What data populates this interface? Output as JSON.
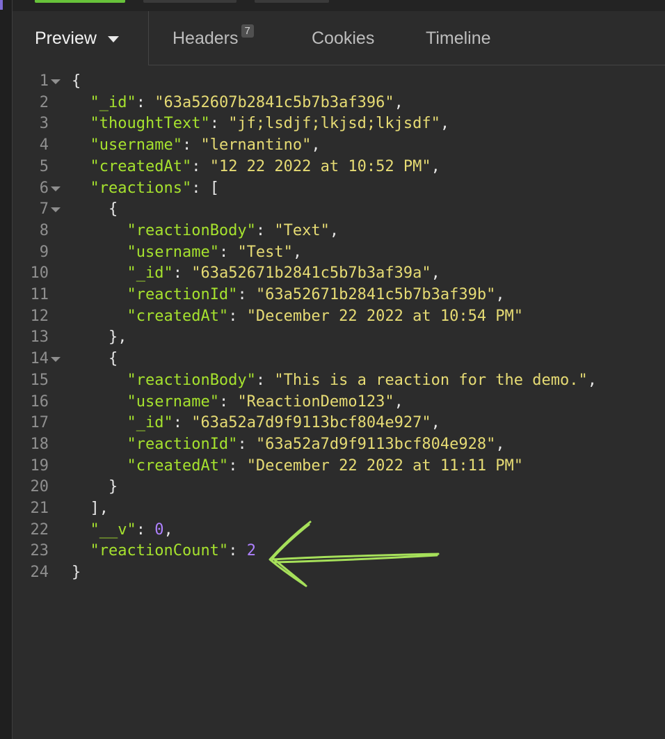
{
  "tabs": [
    {
      "label": "Preview",
      "badge": null,
      "active": true
    },
    {
      "label": "Headers",
      "badge": "7",
      "active": false
    },
    {
      "label": "Cookies",
      "badge": null,
      "active": false
    },
    {
      "label": "Timeline",
      "badge": null,
      "active": false
    }
  ],
  "colors": {
    "key": "#a6e22e",
    "string": "#e6db74",
    "number": "#ae81ff",
    "annotation_arrow": "#a6e05a",
    "top_segment_active": "#67c23a"
  },
  "lines": [
    {
      "n": "1",
      "fold": true,
      "tokens": [
        [
          "p",
          "{"
        ]
      ]
    },
    {
      "n": "2",
      "fold": false,
      "tokens": [
        [
          "p",
          "  "
        ],
        [
          "k",
          "\"_id\""
        ],
        [
          "p",
          ": "
        ],
        [
          "s",
          "\"63a52607b2841c5b7b3af396\""
        ],
        [
          "p",
          ","
        ]
      ]
    },
    {
      "n": "3",
      "fold": false,
      "tokens": [
        [
          "p",
          "  "
        ],
        [
          "k",
          "\"thoughtText\""
        ],
        [
          "p",
          ": "
        ],
        [
          "s",
          "\"jf;lsdjf;lkjsd;lkjsdf\""
        ],
        [
          "p",
          ","
        ]
      ]
    },
    {
      "n": "4",
      "fold": false,
      "tokens": [
        [
          "p",
          "  "
        ],
        [
          "k",
          "\"username\""
        ],
        [
          "p",
          ": "
        ],
        [
          "s",
          "\"lernantino\""
        ],
        [
          "p",
          ","
        ]
      ]
    },
    {
      "n": "5",
      "fold": false,
      "tokens": [
        [
          "p",
          "  "
        ],
        [
          "k",
          "\"createdAt\""
        ],
        [
          "p",
          ": "
        ],
        [
          "s",
          "\"12 22 2022 at 10:52 PM\""
        ],
        [
          "p",
          ","
        ]
      ]
    },
    {
      "n": "6",
      "fold": true,
      "tokens": [
        [
          "p",
          "  "
        ],
        [
          "k",
          "\"reactions\""
        ],
        [
          "p",
          ": ["
        ]
      ]
    },
    {
      "n": "7",
      "fold": true,
      "tokens": [
        [
          "p",
          "    {"
        ]
      ]
    },
    {
      "n": "8",
      "fold": false,
      "tokens": [
        [
          "p",
          "      "
        ],
        [
          "k",
          "\"reactionBody\""
        ],
        [
          "p",
          ": "
        ],
        [
          "s",
          "\"Text\""
        ],
        [
          "p",
          ","
        ]
      ]
    },
    {
      "n": "9",
      "fold": false,
      "tokens": [
        [
          "p",
          "      "
        ],
        [
          "k",
          "\"username\""
        ],
        [
          "p",
          ": "
        ],
        [
          "s",
          "\"Test\""
        ],
        [
          "p",
          ","
        ]
      ]
    },
    {
      "n": "10",
      "fold": false,
      "tokens": [
        [
          "p",
          "      "
        ],
        [
          "k",
          "\"_id\""
        ],
        [
          "p",
          ": "
        ],
        [
          "s",
          "\"63a52671b2841c5b7b3af39a\""
        ],
        [
          "p",
          ","
        ]
      ]
    },
    {
      "n": "11",
      "fold": false,
      "tokens": [
        [
          "p",
          "      "
        ],
        [
          "k",
          "\"reactionId\""
        ],
        [
          "p",
          ": "
        ],
        [
          "s",
          "\"63a52671b2841c5b7b3af39b\""
        ],
        [
          "p",
          ","
        ]
      ]
    },
    {
      "n": "12",
      "fold": false,
      "tokens": [
        [
          "p",
          "      "
        ],
        [
          "k",
          "\"createdAt\""
        ],
        [
          "p",
          ": "
        ],
        [
          "s",
          "\"December 22 2022 at 10:54 PM\""
        ]
      ]
    },
    {
      "n": "13",
      "fold": false,
      "tokens": [
        [
          "p",
          "    },"
        ]
      ]
    },
    {
      "n": "14",
      "fold": true,
      "tokens": [
        [
          "p",
          "    {"
        ]
      ]
    },
    {
      "n": "15",
      "fold": false,
      "tokens": [
        [
          "p",
          "      "
        ],
        [
          "k",
          "\"reactionBody\""
        ],
        [
          "p",
          ": "
        ],
        [
          "s",
          "\"This is a reaction for the demo.\""
        ],
        [
          "p",
          ","
        ]
      ]
    },
    {
      "n": "16",
      "fold": false,
      "tokens": [
        [
          "p",
          "      "
        ],
        [
          "k",
          "\"username\""
        ],
        [
          "p",
          ": "
        ],
        [
          "s",
          "\"ReactionDemo123\""
        ],
        [
          "p",
          ","
        ]
      ]
    },
    {
      "n": "17",
      "fold": false,
      "tokens": [
        [
          "p",
          "      "
        ],
        [
          "k",
          "\"_id\""
        ],
        [
          "p",
          ": "
        ],
        [
          "s",
          "\"63a52a7d9f9113bcf804e927\""
        ],
        [
          "p",
          ","
        ]
      ]
    },
    {
      "n": "18",
      "fold": false,
      "tokens": [
        [
          "p",
          "      "
        ],
        [
          "k",
          "\"reactionId\""
        ],
        [
          "p",
          ": "
        ],
        [
          "s",
          "\"63a52a7d9f9113bcf804e928\""
        ],
        [
          "p",
          ","
        ]
      ]
    },
    {
      "n": "19",
      "fold": false,
      "tokens": [
        [
          "p",
          "      "
        ],
        [
          "k",
          "\"createdAt\""
        ],
        [
          "p",
          ": "
        ],
        [
          "s",
          "\"December 22 2022 at 11:11 PM\""
        ]
      ]
    },
    {
      "n": "20",
      "fold": false,
      "tokens": [
        [
          "p",
          "    }"
        ]
      ]
    },
    {
      "n": "21",
      "fold": false,
      "tokens": [
        [
          "p",
          "  ],"
        ]
      ]
    },
    {
      "n": "22",
      "fold": false,
      "tokens": [
        [
          "p",
          "  "
        ],
        [
          "k",
          "\"__v\""
        ],
        [
          "p",
          ": "
        ],
        [
          "n",
          "0"
        ],
        [
          "p",
          ","
        ]
      ]
    },
    {
      "n": "23",
      "fold": false,
      "tokens": [
        [
          "p",
          "  "
        ],
        [
          "k",
          "\"reactionCount\""
        ],
        [
          "p",
          ": "
        ],
        [
          "n",
          "2"
        ]
      ]
    },
    {
      "n": "24",
      "fold": false,
      "tokens": [
        [
          "p",
          "}"
        ]
      ]
    }
  ]
}
